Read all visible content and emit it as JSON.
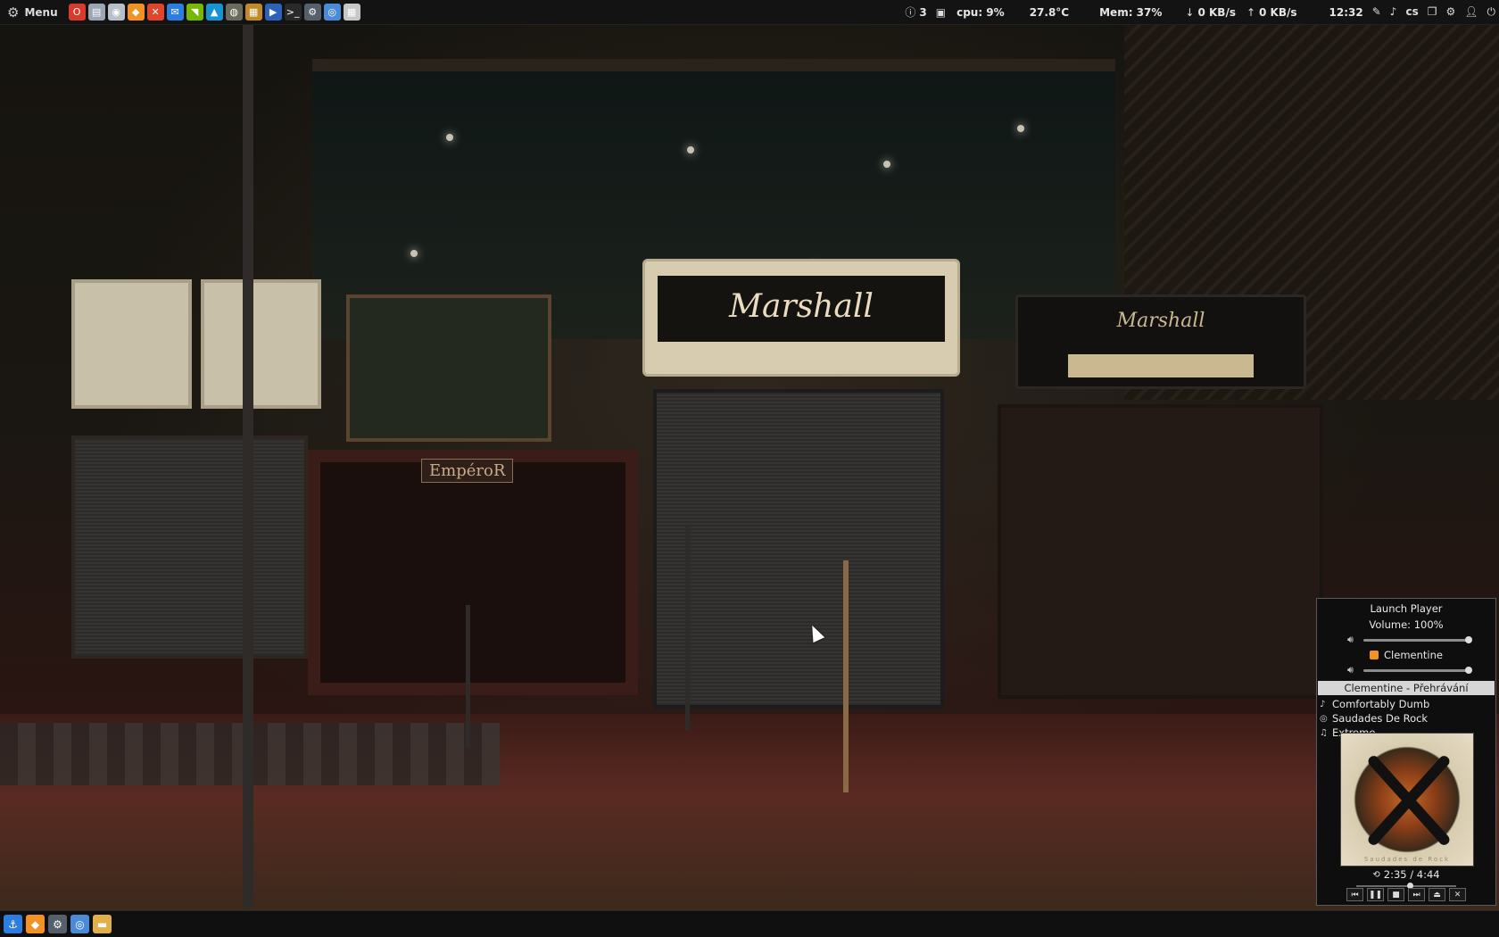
{
  "top_panel": {
    "menu_label": "Menu",
    "launchers": [
      {
        "icon": "opera-icon",
        "color": "#d93b2b",
        "glyph": "O"
      },
      {
        "icon": "file-manager-icon",
        "color": "#9aa6b2",
        "glyph": "▤"
      },
      {
        "icon": "pidgin-icon",
        "color": "#b7c0c8",
        "glyph": "◉"
      },
      {
        "icon": "clementine-icon",
        "color": "#f39222",
        "glyph": "◆"
      },
      {
        "icon": "ccleaner-icon",
        "color": "#e0452c",
        "glyph": "✕"
      },
      {
        "icon": "chat-icon",
        "color": "#2d7de0",
        "glyph": "✉"
      },
      {
        "icon": "nvidia-icon",
        "color": "#76b900",
        "glyph": "◥"
      },
      {
        "icon": "arch-icon",
        "color": "#1793d1",
        "glyph": "▲"
      },
      {
        "icon": "gimp-icon",
        "color": "#6b6b5b",
        "glyph": "◍"
      },
      {
        "icon": "media-icon",
        "color": "#c08a2a",
        "glyph": "▦"
      },
      {
        "icon": "video-player-icon",
        "color": "#2d62b8",
        "glyph": "▶"
      },
      {
        "icon": "terminal-icon",
        "color": "#2a2a2a",
        "glyph": ">_"
      },
      {
        "icon": "settings-icon",
        "color": "#55606a",
        "glyph": "⚙"
      },
      {
        "icon": "chromium-icon",
        "color": "#4b8ad6",
        "glyph": "◎"
      },
      {
        "icon": "calculator-icon",
        "color": "#c7c7c7",
        "glyph": "▦"
      }
    ],
    "notifications_count": "3",
    "cpu": "cpu: 9%",
    "temperature": "27.8°C",
    "memory": "Mem:  37%",
    "net_down": "0 KB/s",
    "net_up": "0 KB/s",
    "clock": "12:32",
    "keyboard_layout": "cs",
    "tray_icons": [
      "pen-icon",
      "music-note-icon",
      "keyboard-layout",
      "windows-icon",
      "gear-icon",
      "user-icon",
      "power-icon"
    ]
  },
  "player": {
    "launch_label": "Launch Player",
    "volume_label": "Volume: 100%",
    "volume_level": 1.0,
    "app_volume_level": 1.0,
    "app_name": "Clementine",
    "now_playing_header": "Clementine - Přehrávání",
    "track_title": "Comfortably Dumb",
    "album": "Saudades De Rock",
    "artist": "Extreme",
    "album_cover_caption": "Saudades de Rock",
    "time": "2:35 / 4:44",
    "progress": 0.546,
    "controls": [
      "previous",
      "pause",
      "stop",
      "next",
      "eject",
      "close"
    ]
  },
  "wallpaper": {
    "amp_logo_1": "Marshall",
    "amp_logo_2": "Marshall",
    "amp_logo_3": "EmpéroR"
  },
  "bottom_panel": {
    "tasks": [
      {
        "icon": "anchor-icon",
        "color": "#2d7de0",
        "glyph": "⚓"
      },
      {
        "icon": "clementine-icon",
        "color": "#f39222",
        "glyph": "◆"
      },
      {
        "icon": "system-monitor-icon",
        "color": "#55606a",
        "glyph": "⚙"
      },
      {
        "icon": "chromium-icon",
        "color": "#4b8ad6",
        "glyph": "◎"
      },
      {
        "icon": "folder-icon",
        "color": "#e2b04a",
        "glyph": "▬"
      }
    ]
  }
}
